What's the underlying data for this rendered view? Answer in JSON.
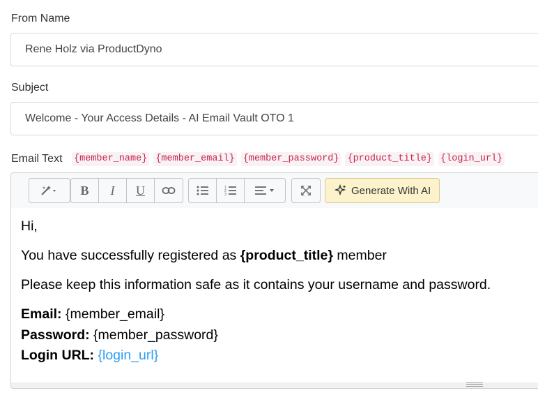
{
  "from_name": {
    "label": "From Name",
    "value": "Rene Holz via ProductDyno"
  },
  "subject": {
    "label": "Subject",
    "value": "Welcome - Your Access Details - AI Email Vault OTO 1"
  },
  "email_text": {
    "label": "Email Text",
    "tags": [
      "{member_name}",
      "{member_email}",
      "{member_password}",
      "{product_title}",
      "{login_url}"
    ]
  },
  "toolbar": {
    "magic_icon": "magic-wand-icon",
    "bold_label": "B",
    "italic_label": "I",
    "underline_label": "U",
    "link_icon": "link-icon",
    "ul_icon": "unordered-list-icon",
    "ol_icon": "ordered-list-icon",
    "align_icon": "align-icon",
    "fullscreen_icon": "fullscreen-icon",
    "ai_label": "Generate With AI",
    "ai_icon": "sparkle-icon",
    "ai_color": "#fcf3cc"
  },
  "body": {
    "greeting": "Hi,",
    "registered_prefix": "You have successfully registered as",
    "registered_tag": "{product_title}",
    "registered_suffix": "member",
    "keep_safe": "Please keep this information safe as it contains your username and password.",
    "email_label": "Email:",
    "email_value": "{member_email}",
    "password_label": "Password:",
    "password_value": "{member_password}",
    "login_label": "Login URL:",
    "login_value": "{login_url}",
    "link_color": "#2a9df4"
  }
}
